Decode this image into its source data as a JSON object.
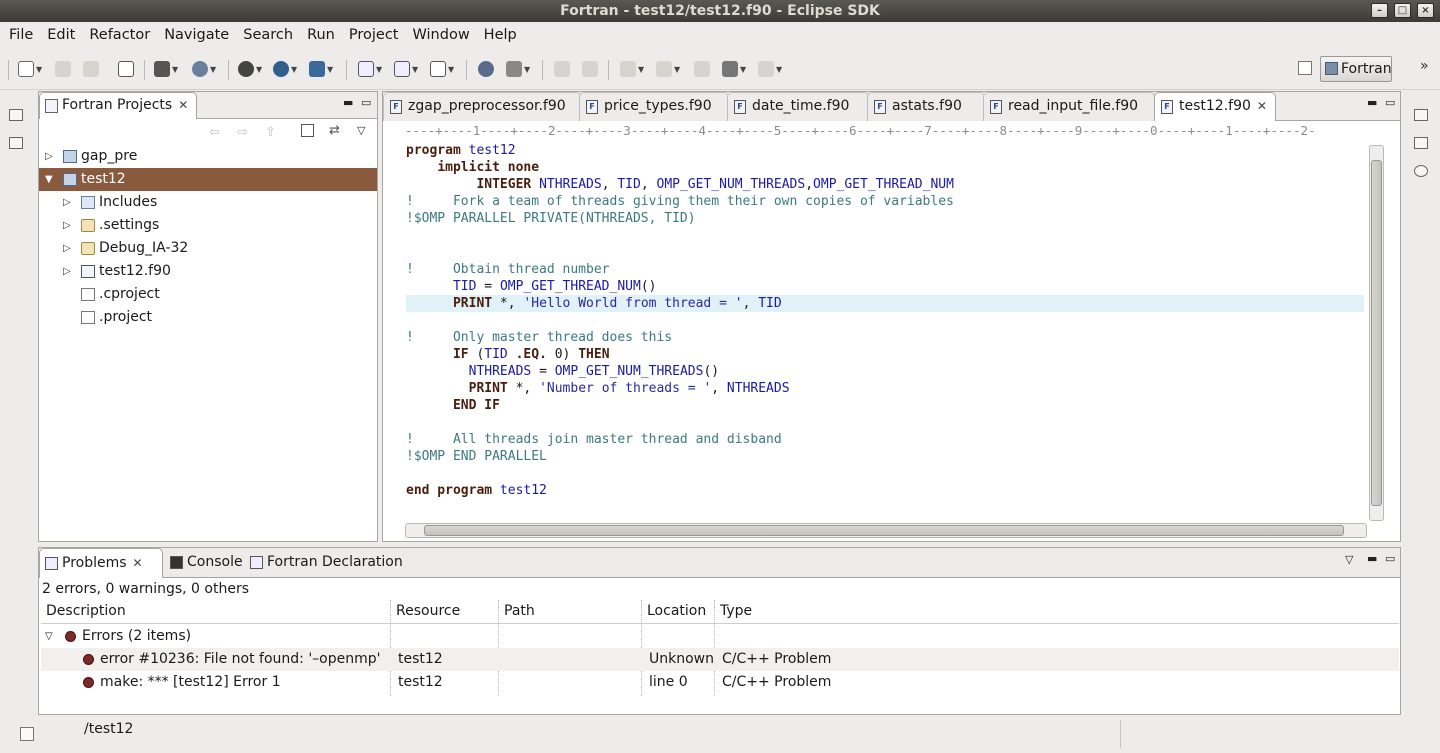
{
  "window": {
    "title": "Fortran - test12/test12.f90 - Eclipse SDK"
  },
  "menu": [
    "File",
    "Edit",
    "Refactor",
    "Navigate",
    "Search",
    "Run",
    "Project",
    "Window",
    "Help"
  ],
  "perspective": {
    "label": "Fortran"
  },
  "project_view": {
    "tab_label": "Fortran Projects",
    "tree": [
      {
        "label": "gap_pre",
        "expanded": false
      },
      {
        "label": "test12",
        "expanded": true,
        "selected": true
      },
      {
        "label": "Includes"
      },
      {
        "label": ".settings"
      },
      {
        "label": "Debug_IA-32"
      },
      {
        "label": "test12.f90"
      },
      {
        "label": ".cproject"
      },
      {
        "label": ".project"
      }
    ]
  },
  "editor": {
    "tabs": [
      "zgap_preprocessor.f90",
      "price_types.f90",
      "date_time.f90",
      "astats.f90",
      "read_input_file.f90",
      "test12.f90"
    ],
    "active_tab": "test12.f90",
    "ruler": "----+----1----+----2----+----3----+----4----+----5----+----6----+----7----+----8----+----9----+----0----+----1----+----2-",
    "code_lines": [
      "program test12",
      "    implicit none",
      "         INTEGER NTHREADS, TID, OMP_GET_NUM_THREADS,OMP_GET_THREAD_NUM",
      "!     Fork a team of threads giving them their own copies of variables",
      "!$OMP PARALLEL PRIVATE(NTHREADS, TID)",
      "",
      "",
      "!     Obtain thread number",
      "      TID = OMP_GET_THREAD_NUM()",
      "      PRINT *, 'Hello World from thread = ', TID",
      "",
      "!     Only master thread does this",
      "      IF (TID .EQ. 0) THEN",
      "        NTHREADS = OMP_GET_NUM_THREADS()",
      "        PRINT *, 'Number of threads = ', NTHREADS",
      "      END IF",
      "",
      "!     All threads join master thread and disband",
      "!$OMP END PARALLEL",
      "",
      "end program test12"
    ],
    "highlighted_line": "      PRINT *, 'Hello World from thread = ', TID"
  },
  "bottom_panel": {
    "tabs": [
      "Problems",
      "Console",
      "Fortran Declaration"
    ],
    "active_tab": "Problems",
    "summary": "2 errors, 0 warnings, 0 others",
    "columns": [
      "Description",
      "Resource",
      "Path",
      "Location",
      "Type"
    ],
    "group": {
      "label": "Errors (2 items)"
    },
    "rows": [
      {
        "description": "error #10236: File not found:  '–openmp'",
        "resource": "test12",
        "path": "",
        "location": "Unknown",
        "type": "C/C++ Problem"
      },
      {
        "description": "make: *** [test12] Error 1",
        "resource": "test12",
        "path": "",
        "location": "line 0",
        "type": "C/C++ Problem"
      }
    ]
  },
  "status_bar": {
    "text": "/test12"
  },
  "colors": {
    "selection": "#8a5a3f",
    "current_line": "#e0f2f7",
    "keyword": "#4a1e0e",
    "identifier": "#1a1aa6",
    "comment": "#3c7a80"
  }
}
